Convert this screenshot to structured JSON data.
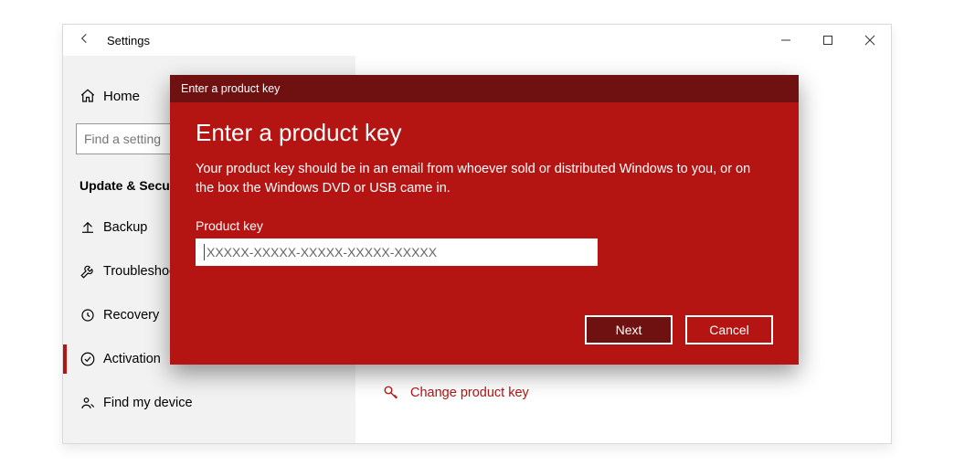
{
  "window": {
    "title": "Settings"
  },
  "sidebar": {
    "home": "Home",
    "search_placeholder": "Find a setting",
    "section": "Update & Security",
    "items": [
      {
        "label": "Backup"
      },
      {
        "label": "Troubleshoot"
      },
      {
        "label": "Recovery"
      },
      {
        "label": "Activation"
      },
      {
        "label": "Find my device"
      }
    ]
  },
  "content": {
    "change_key": "Change product key"
  },
  "modal": {
    "header": "Enter a product key",
    "title": "Enter a product key",
    "description": "Your product key should be in an email from whoever sold or distributed Windows to you, or on the box the Windows DVD or USB came in.",
    "field_label": "Product key",
    "field_placeholder": "XXXXX-XXXXX-XXXXX-XXXXX-XXXXX",
    "next": "Next",
    "cancel": "Cancel"
  }
}
